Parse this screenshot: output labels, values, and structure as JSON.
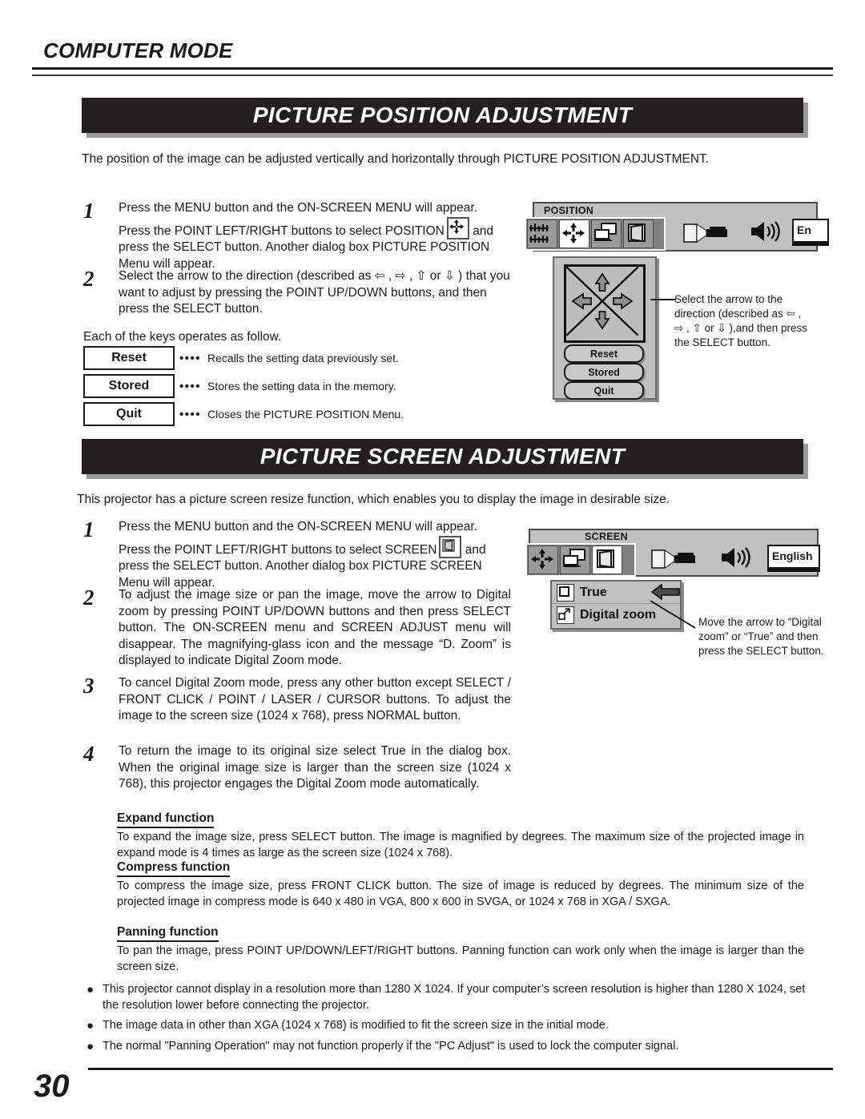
{
  "running_head": "COMPUTER MODE",
  "page_number": "30",
  "section1": {
    "banner": "PICTURE POSITION ADJUSTMENT",
    "intro": "The position of the image can be adjusted vertically and horizontally through PICTURE POSITION ADJUSTMENT.",
    "steps": [
      {
        "num": "1",
        "text_a": "Press the MENU button and the ON-SCREEN MENU will appear. Press the POINT LEFT/RIGHT buttons to select POSITION",
        "text_b": "and press the SELECT button.  Another dialog box PICTURE POSITION Menu will appear.",
        "icon": "position-arrows-icon"
      },
      {
        "num": "2",
        "text_a": "Select the arrow to the direction (described as ⇦ , ⇨ , ⇧ or ⇩ ) that you want to adjust by pressing the POINT UP/DOWN buttons, and then press the SELECT button.",
        "text_b": "",
        "icon": ""
      }
    ],
    "keys_lead": "Each of the keys operates as follow.",
    "keys": [
      {
        "label": "Reset",
        "dots": "••••",
        "desc": "Recalls the setting data previously set."
      },
      {
        "label": "Stored",
        "dots": "••••",
        "desc": "Stores the setting data in the memory."
      },
      {
        "label": "Quit",
        "dots": "••••",
        "desc": "Closes the PICTURE POSITION Menu."
      }
    ],
    "osd": {
      "title": "POSITION",
      "toolbar_icons": [
        "sliders-icon",
        "position-arrows-icon",
        "computer-icon",
        "screen-icon"
      ],
      "right_icons": [
        "projector-icon",
        "volume-icon"
      ],
      "language_value": "En",
      "dialog_buttons": [
        "Reset",
        "Stored",
        "Quit"
      ],
      "arrows": [
        "up-arrow-icon",
        "left-arrow-icon",
        "right-arrow-icon",
        "down-arrow-icon"
      ]
    },
    "callout": "Select the arrow to the direction (described as ⇦ ,  ⇨ ,  ⇧  or ⇩ ),and then press the SELECT button."
  },
  "section2": {
    "banner": "PICTURE SCREEN ADJUSTMENT",
    "intro": "This projector has a picture screen resize function, which enables you to display the image in desirable size.",
    "steps": [
      {
        "num": "1",
        "text_a": "Press the MENU button and the ON-SCREEN MENU will appear. Press the POINT LEFT/RIGHT buttons to select SCREEN",
        "text_b": "and press the SELECT button.  Another dialog box PICTURE SCREEN Menu will appear.",
        "icon": "screen-icon"
      },
      {
        "num": "2",
        "text_a": "To adjust the image size or pan the image, move the arrow to Digital zoom by pressing POINT UP/DOWN buttons and then press SELECT button.  The ON-SCREEN menu and SCREEN ADJUST menu will disappear.  The magnifying-glass icon and the message “D. Zoom” is displayed to indicate Digital Zoom mode.",
        "text_b": "",
        "icon": ""
      },
      {
        "num": "3",
        "text_a": "To cancel Digital Zoom mode, press any other button except SELECT / FRONT CLICK / POINT / LASER / CURSOR buttons. To adjust the image to the screen size (1024 x 768), press NORMAL button.",
        "text_b": "",
        "icon": ""
      },
      {
        "num": "4",
        "text_a": "To return the image to its original size select True in the dialog box.  When the original image size is larger than the screen size (1024 x 768), this projector engages the Digital Zoom mode automatically.",
        "text_b": "",
        "icon": ""
      }
    ],
    "osd": {
      "title": "SCREEN",
      "toolbar_icons": [
        "position-arrows-icon",
        "computer-icon",
        "screen-icon"
      ],
      "right_icons": [
        "projector-icon",
        "volume-icon"
      ],
      "language_value": "English",
      "menu_items": [
        {
          "label": "True",
          "icon": "true-square-icon"
        },
        {
          "label": "Digital zoom",
          "icon": "digital-zoom-icon"
        }
      ],
      "pointer": "left-arrow-pointer-icon"
    },
    "callout": "Move the arrow to “Digital zoom” or “True” and then press the SELECT button.",
    "functions": [
      {
        "heading": "Expand function",
        "text": "To expand the image size, press SELECT button.  The image is magnified by degrees. The maximum size of the projected image in expand mode is 4 times as large as the screen size (1024 x 768)."
      },
      {
        "heading": "Compress function",
        "text": "To compress the image size, press FRONT CLICK button.  The size of image is reduced by degrees.  The minimum size of the projected image in compress mode is 640 x 480 in VGA, 800 x 600 in SVGA, or 1024 x 768 in XGA / SXGA."
      },
      {
        "heading": "Panning function",
        "text": "To pan the image, press POINT UP/DOWN/LEFT/RIGHT buttons.  Panning function can work only when the image is larger than the screen size."
      }
    ],
    "bullets": [
      "This projector cannot display in a resolution more than 1280 X 1024.  If your computer’s screen resolution is higher than 1280 X 1024, set the resolution lower before connecting the projector.",
      "The image data in other than XGA (1024 x 768) is modified to fit the screen size in the initial mode.",
      "The normal \"Panning Operation\" may not function properly if the \"PC Adjust\" is used to lock the computer signal."
    ]
  }
}
